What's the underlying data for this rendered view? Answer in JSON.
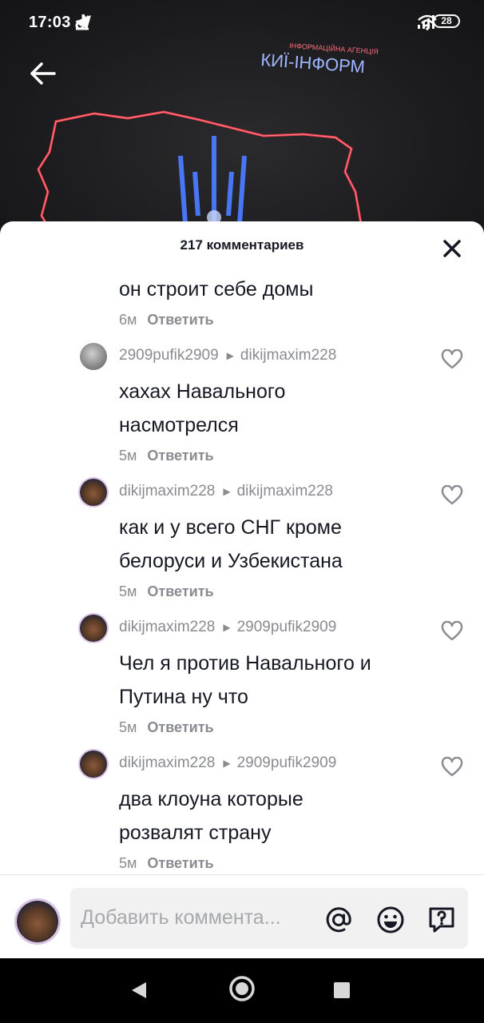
{
  "status_bar": {
    "time": "17:03",
    "left_icons": [
      "tiktok-icon",
      "telegram-icon",
      "download-check-icon"
    ],
    "right_icons": [
      "signal-icon",
      "wifi-icon"
    ],
    "battery": "28"
  },
  "video": {
    "overlay_brand": "КИЇ-ІНФОРМ",
    "overlay_small": "ІНФОРМАЦІЙНА АГЕНЦІЯ"
  },
  "sheet": {
    "title": "217 комментариев"
  },
  "comments": [
    {
      "text_lines": [
        "он строит себе домы"
      ],
      "time": "6м",
      "reply_label": "Ответить"
    },
    {
      "author": "2909pufik2909",
      "reply_to": "dikijmaxim228",
      "text_lines": [
        "хахах Навального",
        "насмотрелся"
      ],
      "time": "5м",
      "reply_label": "Ответить"
    },
    {
      "author": "dikijmaxim228",
      "reply_to": "dikijmaxim228",
      "text_lines": [
        "как и у всего СНГ кроме",
        "белоруси и Узбекистана"
      ],
      "time": "5м",
      "reply_label": "Ответить"
    },
    {
      "author": "dikijmaxim228",
      "reply_to": "2909pufik2909",
      "text_lines": [
        "Чел я против Навального и",
        "Путина ну что"
      ],
      "time": "5м",
      "reply_label": "Ответить"
    },
    {
      "author": "dikijmaxim228",
      "reply_to": "2909pufik2909",
      "text_lines": [
        "два клоуна которые",
        "розвалят страну"
      ],
      "time": "5м",
      "reply_label": "Ответить"
    }
  ],
  "input": {
    "placeholder": "Добавить коммента..."
  },
  "colors": {
    "text_primary": "#161823",
    "text_secondary": "#8a8b91",
    "neon_red": "#ff3b4a",
    "neon_blue": "#4a7bff"
  }
}
